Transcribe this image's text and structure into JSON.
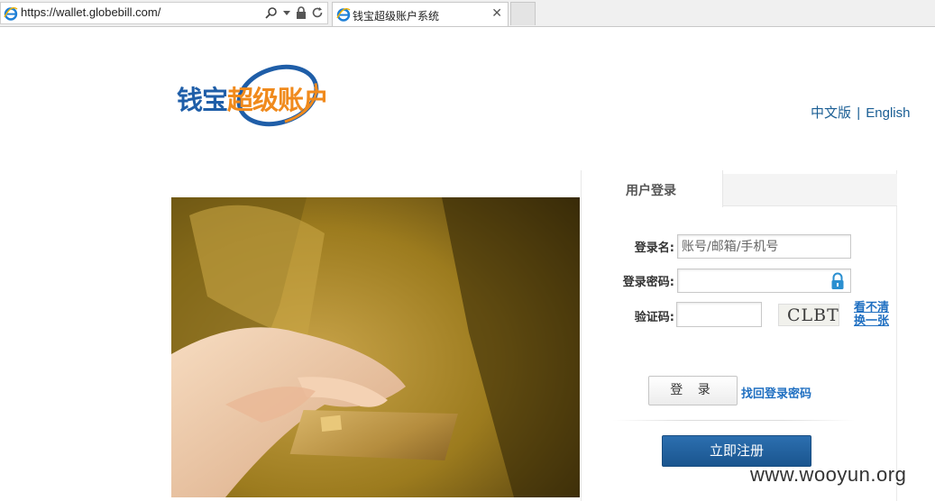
{
  "browser": {
    "url": "https://wallet.globebill.com/",
    "tab_title": "钱宝超级账户系统",
    "close_glyph": "✕"
  },
  "logo": {
    "part_blue_1": "钱宝",
    "part_orange": "超级",
    "part_blue_2": "账户",
    "colors": {
      "blue": "#1f5ea8",
      "orange": "#f08a1c"
    }
  },
  "lang": {
    "chinese": "中文版",
    "separator": "|",
    "english": "English"
  },
  "login": {
    "tab_label": "用户登录",
    "username_label": "登录名:",
    "username_placeholder": "账号/邮箱/手机号",
    "password_label": "登录密码:",
    "captcha_label": "验证码:",
    "captcha_text": "CLBT",
    "refresh_line1": "看不清",
    "refresh_line2": "换一张",
    "login_button": "登 录",
    "forgot_link": "找回登录密码",
    "register_button": "立即注册"
  },
  "watermark": "www.wooyun.org",
  "colors": {
    "link": "#1f6fc1",
    "primary_button": "#1f5f9e"
  }
}
